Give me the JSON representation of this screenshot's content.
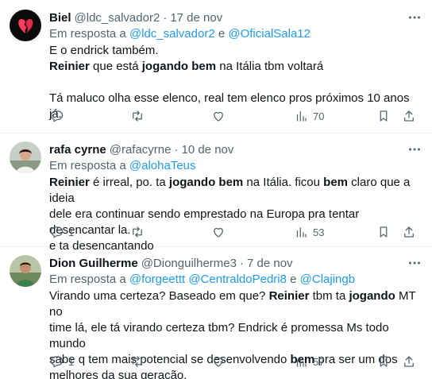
{
  "tweets": [
    {
      "name": "Biel",
      "handle": "@ldc_salvador2",
      "date": "17 de nov",
      "reply_prefix": "Em resposta a ",
      "mentions": [
        "@ldc_salvador2",
        "@OficialSala12"
      ],
      "mention_joiner": " e ",
      "text_lines": [
        [
          {
            "t": "E o endrick também."
          }
        ],
        [
          {
            "t": "Reinier",
            "b": true
          },
          {
            "t": " que está "
          },
          {
            "t": "jogando bem",
            "b": true
          },
          {
            "t": " na Itália tbm voltará"
          }
        ],
        [],
        [
          {
            "t": "Tá maluco olha esse elenco, real tem elenco pros próximos 10 anos já."
          }
        ]
      ],
      "reply_count": "",
      "retweet_count": "",
      "like_count": "",
      "views": "70",
      "avatar_icon": "broken-heart-avatar"
    },
    {
      "name": "rafa cyrne",
      "handle": "@rafacyrne",
      "date": "10 de nov",
      "reply_prefix": "Em resposta a ",
      "mentions": [
        "@alohaTeus"
      ],
      "mention_joiner": "",
      "text_lines": [
        [
          {
            "t": "Reinier",
            "b": true
          },
          {
            "t": " é irreal, po. ta "
          },
          {
            "t": "jogando bem",
            "b": true
          },
          {
            "t": " na Itália. ficou "
          },
          {
            "t": "bem",
            "b": true
          },
          {
            "t": " claro que a ideia"
          }
        ],
        [
          {
            "t": "dele era continuar sendo emprestado na Europa pra tentar desencantar la."
          }
        ],
        [
          {
            "t": "e ta desencantando"
          }
        ]
      ],
      "reply_count": "1",
      "retweet_count": "",
      "like_count": "",
      "views": "53",
      "avatar_icon": "person-photo-avatar"
    },
    {
      "name": "Dion Guilherme",
      "handle": "@Dionguilherme3",
      "date": "7 de nov",
      "reply_prefix": "Em resposta a ",
      "mentions": [
        "@forgeettt",
        "@CentraldoPedri8",
        "@Clajingb"
      ],
      "mention_joiner": " e ",
      "text_lines": [
        [
          {
            "t": "Virando uma certeza? Baseado em que? "
          },
          {
            "t": "Reinier",
            "b": true
          },
          {
            "t": " tbm ta "
          },
          {
            "t": "jogando",
            "b": true
          },
          {
            "t": " MT no"
          }
        ],
        [
          {
            "t": "time lá, ele tá virando certeza tbm? Endrick é promessa Ms todo mundo"
          }
        ],
        [
          {
            "t": "sabe q tem mais potencial se desenvolvendo "
          },
          {
            "t": "bem",
            "b": true
          },
          {
            "t": " pra ser um dos"
          }
        ],
        [
          {
            "t": "melhores da sua geração."
          }
        ]
      ],
      "reply_count": "1",
      "retweet_count": "",
      "like_count": "",
      "views": "57",
      "avatar_icon": "person-photo-avatar"
    }
  ]
}
